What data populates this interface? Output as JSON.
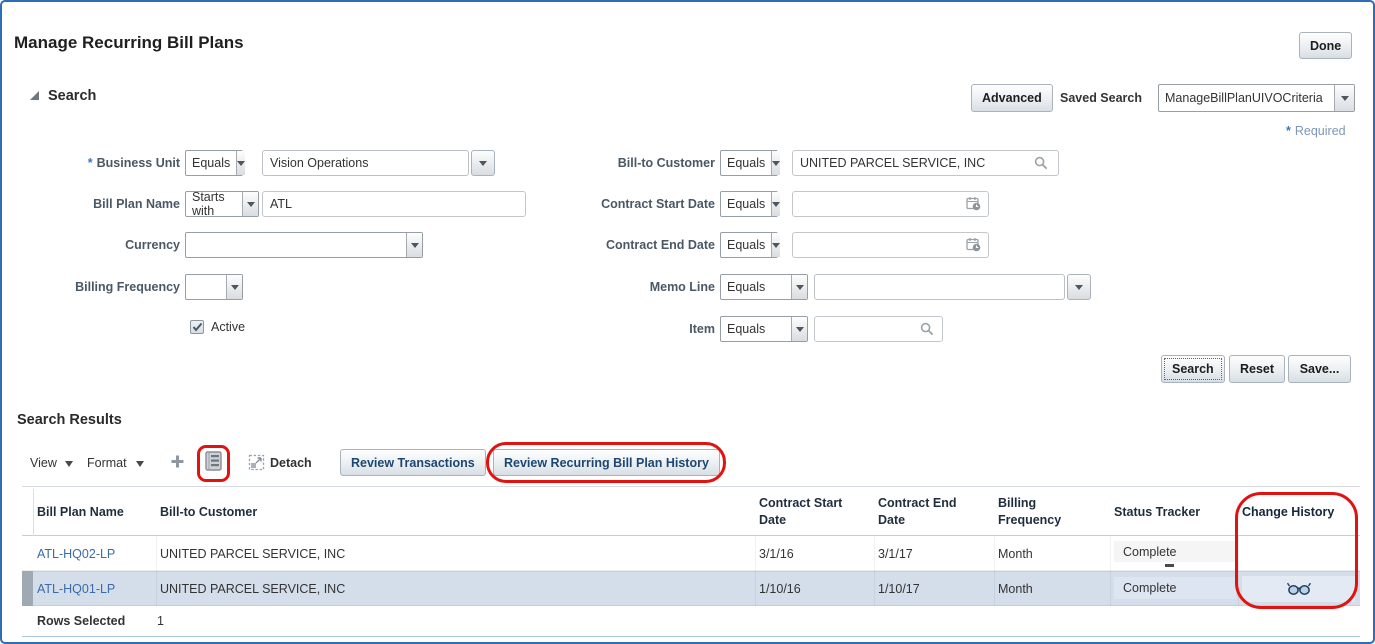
{
  "page": {
    "title": "Manage Recurring Bill Plans",
    "done_label": "Done"
  },
  "search": {
    "heading": "Search",
    "advanced_label": "Advanced",
    "saved_search_label": "Saved Search",
    "saved_search_value": "ManageBillPlanUIVOCriteria",
    "required_symbol": "*",
    "required_note": "Required",
    "fields": {
      "business_unit": {
        "label": "Business Unit",
        "required_marker": "*",
        "operator": "Equals",
        "value": "Vision Operations"
      },
      "bill_plan_name": {
        "label": "Bill Plan Name",
        "operator": "Starts with",
        "value": "ATL"
      },
      "currency": {
        "label": "Currency",
        "value": ""
      },
      "billing_frequency": {
        "label": "Billing Frequency",
        "value": ""
      },
      "active": {
        "label": "Active",
        "checked": true
      },
      "bill_to_customer": {
        "label": "Bill-to Customer",
        "operator": "Equals",
        "value": "UNITED PARCEL SERVICE, INC"
      },
      "contract_start_date": {
        "label": "Contract Start Date",
        "operator": "Equals",
        "value": ""
      },
      "contract_end_date": {
        "label": "Contract End Date",
        "operator": "Equals",
        "value": ""
      },
      "memo_line": {
        "label": "Memo Line",
        "operator": "Equals",
        "value": ""
      },
      "item": {
        "label": "Item",
        "operator": "Equals",
        "value": ""
      }
    },
    "buttons": {
      "search": "Search",
      "reset": "Reset",
      "save": "Save..."
    }
  },
  "results": {
    "heading": "Search Results",
    "toolbar": {
      "view": "View",
      "format": "Format",
      "detach": "Detach",
      "review_transactions": "Review Transactions",
      "review_history": "Review Recurring Bill Plan History"
    },
    "columns": [
      "Bill Plan Name",
      "Bill-to Customer",
      "Contract Start Date",
      "Contract End Date",
      "Billing Frequency",
      "Status Tracker",
      "Change History"
    ],
    "rows": [
      {
        "bill_plan_name": "ATL-HQ02-LP",
        "bill_to_customer": "UNITED PARCEL SERVICE, INC",
        "contract_start": "3/1/16",
        "contract_end": "3/1/17",
        "billing_frequency": "Month",
        "status": "Complete",
        "selected": false,
        "change_history_icon": false
      },
      {
        "bill_plan_name": "ATL-HQ01-LP",
        "bill_to_customer": "UNITED PARCEL SERVICE, INC",
        "contract_start": "1/10/16",
        "contract_end": "1/10/17",
        "billing_frequency": "Month",
        "status": "Complete",
        "selected": true,
        "change_history_icon": true
      }
    ],
    "footer": {
      "rows_selected_label": "Rows Selected",
      "rows_selected_value": "1"
    }
  },
  "icons": {
    "add-icon": "plus glyph",
    "query-by-example-icon": "list page glyph",
    "detach-icon": "dashed square with arrow",
    "search-icon": "magnifier",
    "date-picker-icon": "calendar with clock",
    "glasses-icon": "spectacles (view change history)",
    "dropdown-caret-icon": "down triangle",
    "section-expanded-icon": "corner triangle"
  },
  "colors": {
    "page_border": "#2f6db8",
    "annotation_red": "#e01310",
    "link_blue": "#3c6ba5",
    "selected_row": "#d3deea",
    "label_text": "#4a5866",
    "required_blue": "#3f76c0"
  },
  "annotations": {
    "items": [
      "query-by-example-icon",
      "review-recurring-bill-plan-history-button",
      "change-history-column"
    ]
  }
}
